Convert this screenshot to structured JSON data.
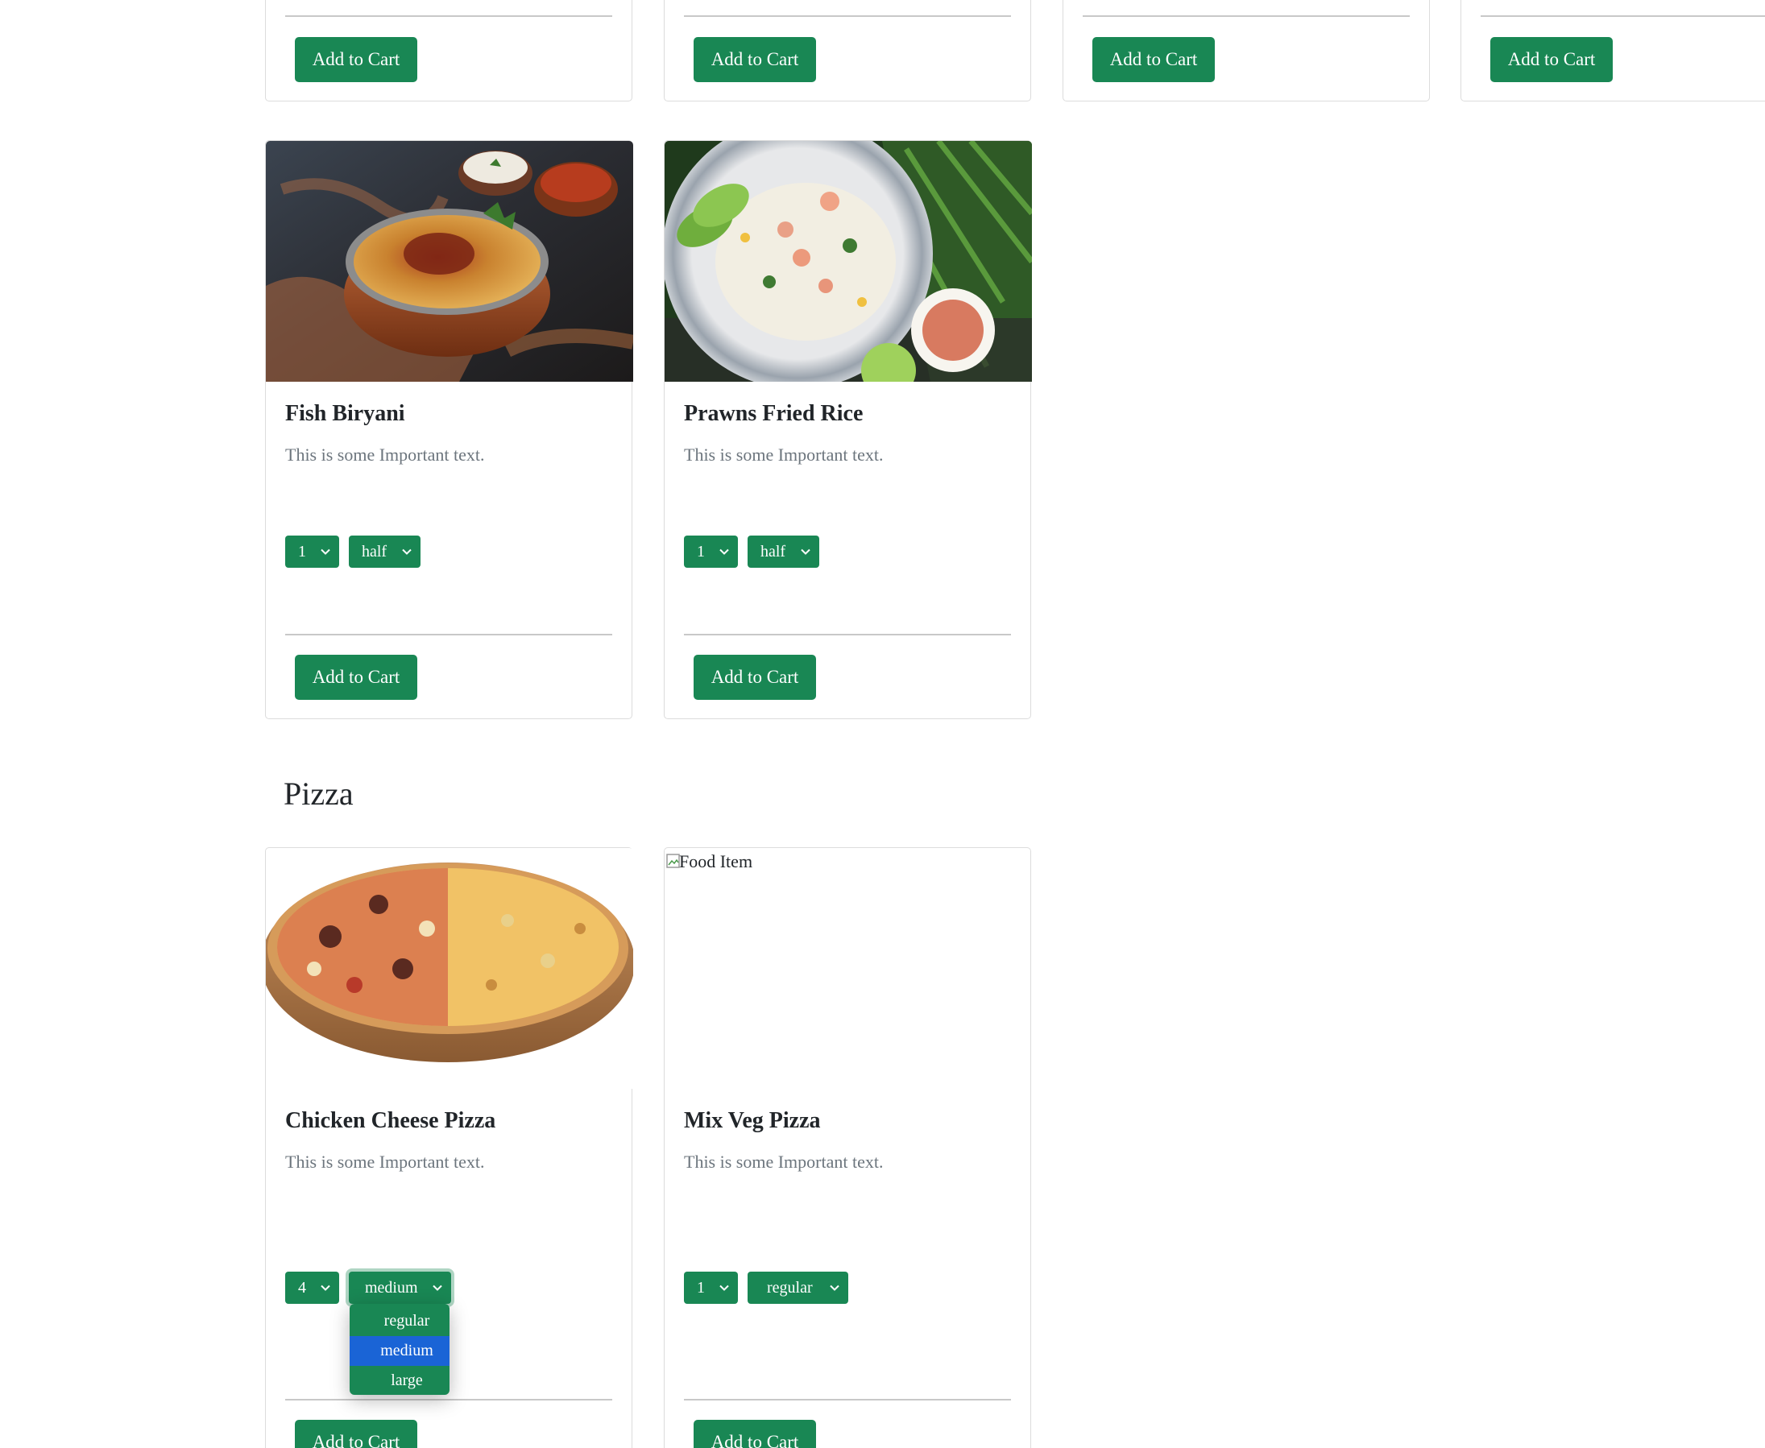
{
  "common": {
    "add_to_cart_label": "Add to Cart",
    "accent_color": "#198754",
    "selection_highlight_color": "#1a64d6"
  },
  "top_row": [
    {
      "button_label": "Add to Cart"
    },
    {
      "button_label": "Add to Cart"
    },
    {
      "button_label": "Add to Cart"
    },
    {
      "button_label": "Add to Cart"
    }
  ],
  "biryani_row": [
    {
      "title": "Fish Biryani",
      "text": "This is some Important text.",
      "quantity": "1",
      "size": "half",
      "image_icon": "biryani-image",
      "button_label": "Add to Cart"
    },
    {
      "title": "Prawns Fried Rice",
      "text": "This is some Important text.",
      "quantity": "1",
      "size": "half",
      "image_icon": "fried-rice-image",
      "button_label": "Add to Cart"
    }
  ],
  "pizza_section": {
    "heading": "Pizza",
    "cards": [
      {
        "title": "Chicken Cheese Pizza",
        "text": "This is some Important text.",
        "quantity": "4",
        "size": "medium",
        "image_icon": "pizza-image",
        "button_label": "Add to Cart"
      },
      {
        "title": "Mix Veg Pizza",
        "text": "This is some Important text.",
        "quantity": "1",
        "size": "regular",
        "image_alt": "Food Item",
        "button_label": "Add to Cart"
      }
    ],
    "size_dropdown": {
      "options": [
        "regular",
        "medium",
        "large"
      ],
      "highlighted": "medium"
    }
  }
}
